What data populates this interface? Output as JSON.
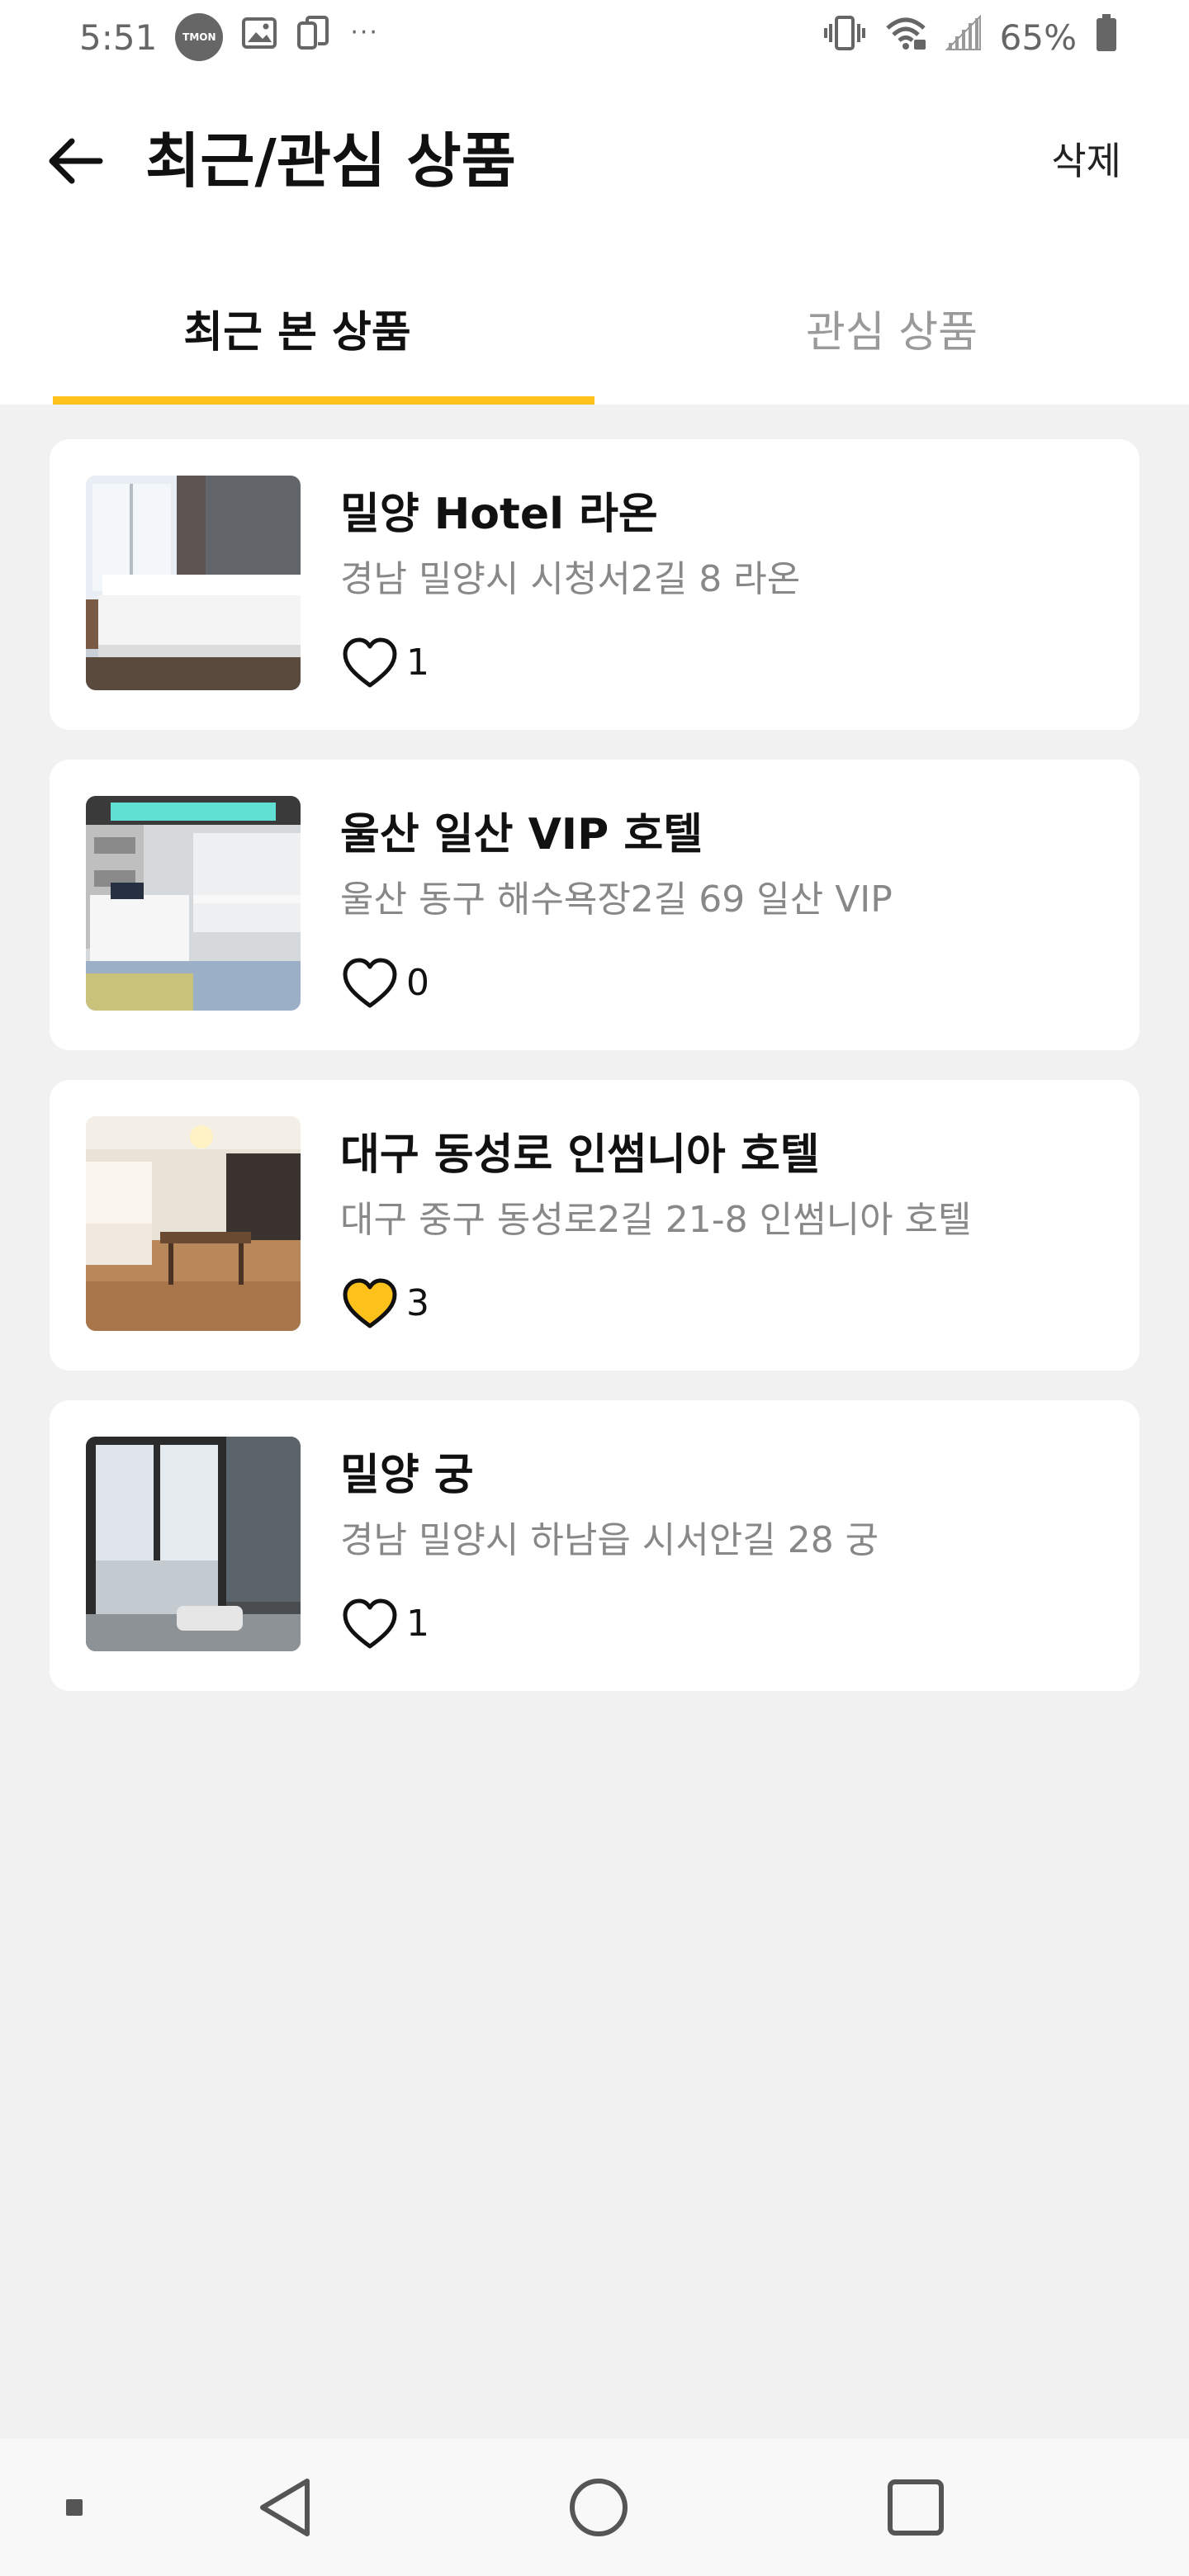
{
  "status_bar": {
    "time": "5:51",
    "app_badge": "TMON",
    "dots": "···",
    "battery": "65%"
  },
  "header": {
    "title": "최근/관심 상품",
    "delete_label": "삭제"
  },
  "tabs": [
    {
      "label": "최근 본 상품",
      "active": true
    },
    {
      "label": "관심 상품",
      "active": false
    }
  ],
  "products": [
    {
      "name": "밀양 Hotel 라온",
      "address": "경남 밀양시 시청서2길 8 라온",
      "likes": "1",
      "liked": false
    },
    {
      "name": "울산 일산 VIP 호텔",
      "address": "울산 동구 해수욕장2길 69 일산 VIP",
      "likes": "0",
      "liked": false
    },
    {
      "name": "대구 동성로 인썸니아 호텔",
      "address": "대구 중구 동성로2길 21-8 인썸니아 호텔",
      "likes": "3",
      "liked": true
    },
    {
      "name": "밀양 궁",
      "address": "경남 밀양시 하남읍 시서안길 28 궁",
      "likes": "1",
      "liked": false
    }
  ],
  "colors": {
    "accent": "#fcc21b",
    "background": "#f1f1f1"
  }
}
